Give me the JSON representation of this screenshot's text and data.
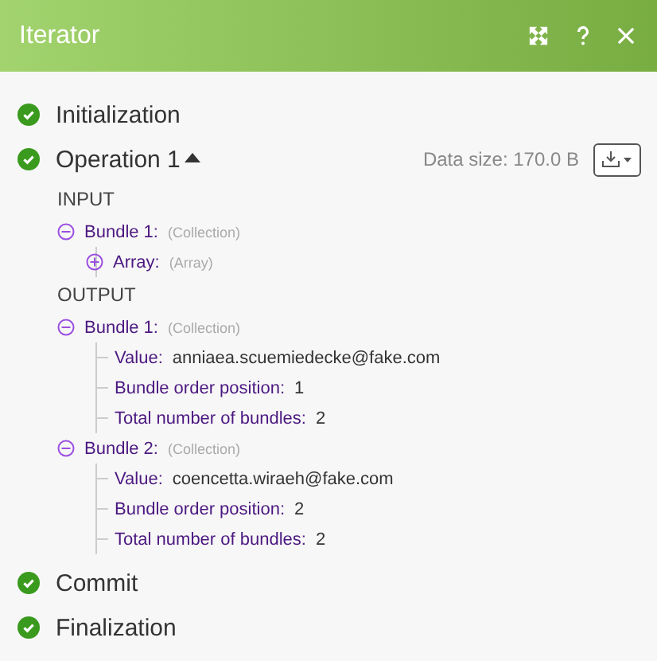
{
  "window": {
    "title": "Iterator"
  },
  "stages": [
    {
      "label": "Initialization",
      "completed": true
    },
    {
      "label": "Operation 1",
      "completed": true,
      "expanded": true,
      "data_size": "Data size: 170.0 B",
      "sections": [
        {
          "title": "INPUT",
          "bundles": [
            {
              "label": "Bundle 1:",
              "type": "(Collection)",
              "expanded": true,
              "items": [
                {
                  "kind": "collection",
                  "label": "Array:",
                  "type": "(Array)",
                  "expanded": false
                }
              ]
            }
          ]
        },
        {
          "title": "OUTPUT",
          "bundles": [
            {
              "label": "Bundle 1:",
              "type": "(Collection)",
              "expanded": true,
              "items": [
                {
                  "kind": "value",
                  "label": "Value:",
                  "value": "anniaea.scuemiedecke@fake.com"
                },
                {
                  "kind": "value",
                  "label": "Bundle order position:",
                  "value": "1"
                },
                {
                  "kind": "value",
                  "label": "Total number of bundles:",
                  "value": "2"
                }
              ]
            },
            {
              "label": "Bundle 2:",
              "type": "(Collection)",
              "expanded": true,
              "items": [
                {
                  "kind": "value",
                  "label": "Value:",
                  "value": "coencetta.wiraeh@fake.com"
                },
                {
                  "kind": "value",
                  "label": "Bundle order position:",
                  "value": "2"
                },
                {
                  "kind": "value",
                  "label": "Total number of bundles:",
                  "value": "2"
                }
              ]
            }
          ]
        }
      ]
    },
    {
      "label": "Commit",
      "completed": true
    },
    {
      "label": "Finalization",
      "completed": true
    }
  ]
}
